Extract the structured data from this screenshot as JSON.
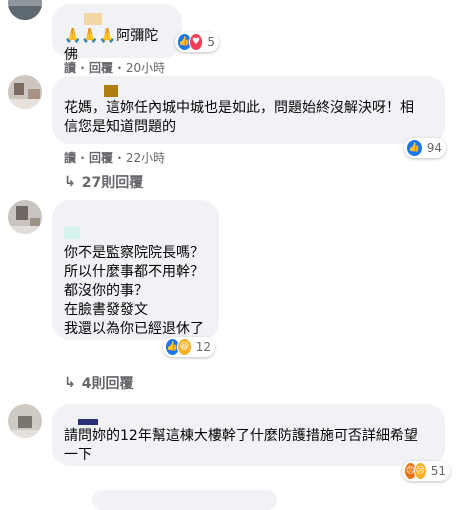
{
  "comments": [
    {
      "text": "🙏🙏🙏阿彌陀佛",
      "name_color": "#f2d6a4",
      "reactions": {
        "count": "5",
        "icons": [
          "like-icon",
          "love-icon"
        ],
        "colors": [
          "#1877f2",
          "#f33e58"
        ]
      }
    },
    {
      "text": "花媽，這妳任內城中城也是如此，問題始終沒解決呀！相\n信您是知道問題的",
      "name_color": "#b07e10",
      "actions": {
        "read": "讀",
        "sep": "·",
        "reply": "回覆",
        "time": "22小時"
      },
      "reactions": {
        "count": "94",
        "icons": [
          "like-icon"
        ],
        "colors": [
          "#1877f2"
        ]
      },
      "replies": {
        "label": "27則回覆"
      }
    },
    {
      "text": "你不是監察院院長嗎？\n所以什麼事都不用幹？\n都沒你的事？\n在臉書發發文\n我還以為你已經退休了",
      "name_color": "#d6f3f0",
      "reactions": {
        "count": "12",
        "icons": [
          "like-icon",
          "haha-icon"
        ],
        "colors": [
          "#1877f2",
          "#f7b125"
        ]
      },
      "replies": {
        "label": "4則回覆"
      }
    },
    {
      "text": "請問妳的12年幫這棟大樓幹了什麼防護措施可否詳細希望\n一下",
      "name_color": "#2a2f7a",
      "reactions": {
        "count": "51",
        "icons": [
          "angry-icon",
          "sad-icon"
        ],
        "colors": [
          "#e9710f",
          "#f7b125"
        ]
      }
    }
  ],
  "top_actions": {
    "read": "讀",
    "sep": "·",
    "reply": "回覆",
    "time": "20小時"
  },
  "mid_actions": {
    "read": "讀",
    "sep": "·",
    "reply": "回覆",
    "time": "20小時"
  }
}
